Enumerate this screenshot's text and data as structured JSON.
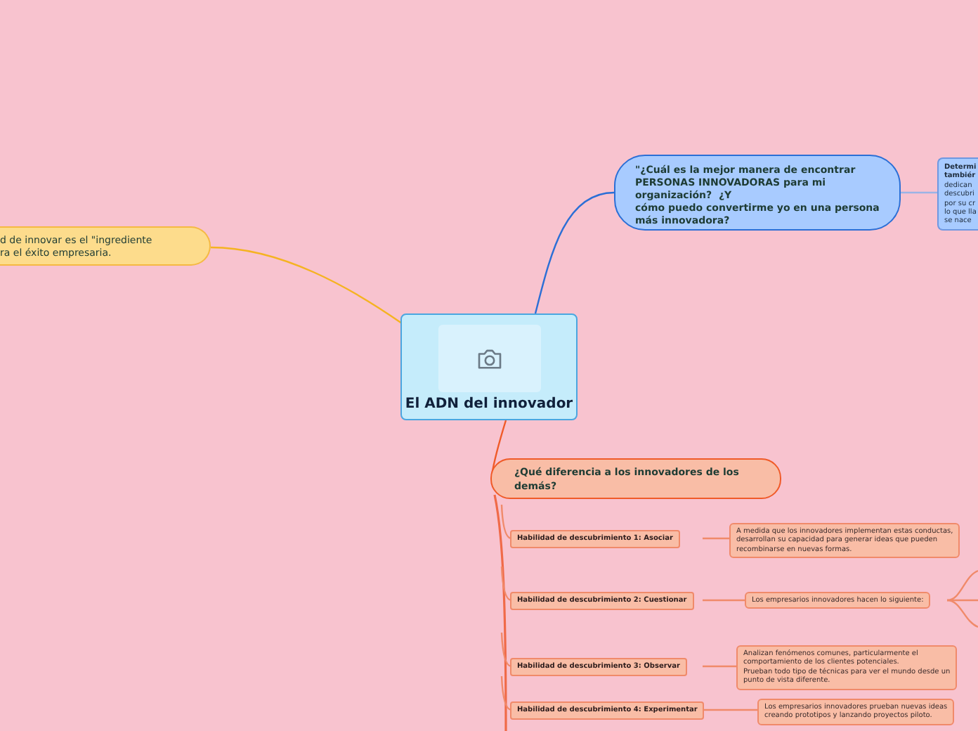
{
  "central_topic": {
    "title": "El ADN del innovador"
  },
  "left_topic": {
    "text": "d de innovar es el \"ingrediente\nra el éxito empresaria."
  },
  "top_topic": {
    "text": "\"¿Cuál es la mejor manera de encontrar\nPERSONAS INNOVADORAS para mi\norganización?  ¿Y\ncómo puedo convertirme yo en una persona\nmás innovadora?",
    "subtopic": {
      "text": "**Determi**\n**tambiér**\ndedican\ndescubri\npor su cr\nlo que lla\nse nace"
    }
  },
  "bottom_topic": {
    "text": "¿Qué diferencia a los innovadores de los\ndemás?",
    "skills": [
      {
        "label": "Habilidad de descubrimiento 1: Asociar",
        "detail": "A medida que los innovadores implementan estas conductas,\ndesarrollan su capacidad para generar ideas que pueden\nrecombinarse en nuevas formas."
      },
      {
        "label": "Habilidad de descubrimiento 2: Cuestionar",
        "detail": "Los empresarios innovadores hacen lo siguiente:"
      },
      {
        "label": "Habilidad de descubrimiento 3: Observar",
        "detail": "Analizan fenómenos comunes, particularmente el\ncomportamiento de los clientes potenciales.\nPrueban todo tipo de técnicas para ver el mundo desde un\npunto de vista diferente."
      },
      {
        "label": "Habilidad de descubrimiento 4: Experimentar",
        "detail": "Los empresarios innovadores prueban nuevas ideas\ncreando prototipos y lanzando proyectos piloto."
      }
    ]
  }
}
